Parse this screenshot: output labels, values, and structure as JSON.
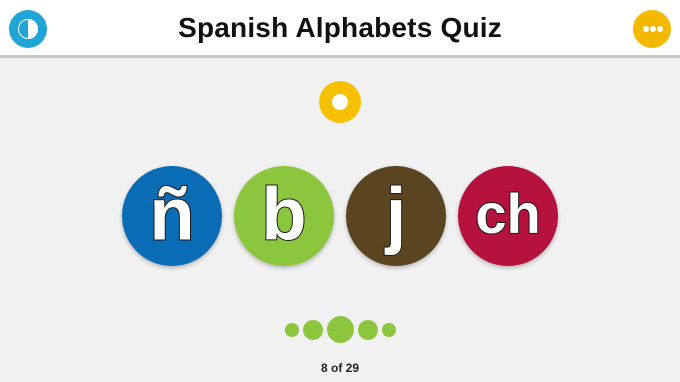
{
  "header": {
    "title": "Spanish Alphabets Quiz"
  },
  "icons": {
    "back": "back-icon",
    "menu": "more-options-icon",
    "speaker": "play-sound-icon"
  },
  "options": [
    {
      "letter": "ñ",
      "color": "#0a6cb5"
    },
    {
      "letter": "b",
      "color": "#8cc63f"
    },
    {
      "letter": "j",
      "color": "#5a4520"
    },
    {
      "letter": "ch",
      "color": "#b5123e"
    }
  ],
  "progress": {
    "current": 8,
    "total": 29,
    "label": "8 of 29"
  },
  "colors": {
    "accent_blue": "#1fa5d6",
    "accent_yellow": "#f5b800",
    "progress_green": "#8cc63f"
  }
}
